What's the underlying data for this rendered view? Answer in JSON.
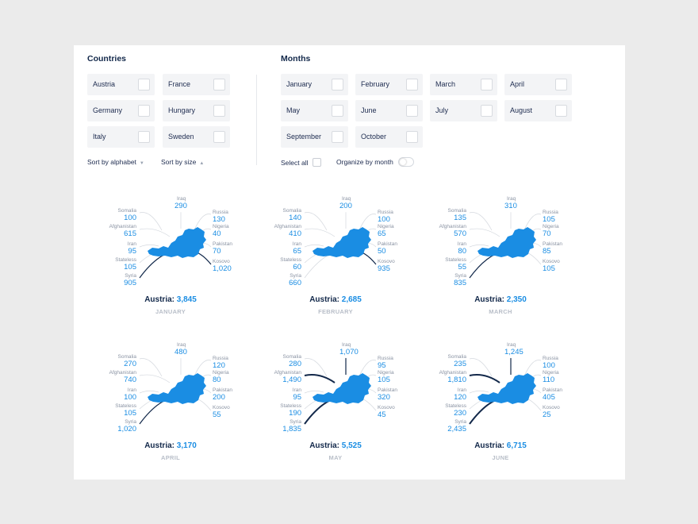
{
  "filters": {
    "countries_title": "Countries",
    "countries": [
      "Austria",
      "France",
      "Germany",
      "Hungary",
      "Italy",
      "Sweden"
    ],
    "sort_alphabet": "Sort by alphabet",
    "sort_size": "Sort by size",
    "months_title": "Months",
    "months": [
      "January",
      "February",
      "March",
      "April",
      "May",
      "June",
      "July",
      "August",
      "September",
      "October"
    ],
    "select_all": "Select all",
    "organize_by_month": "Organize by month"
  },
  "charts": [
    {
      "month": "JANUARY",
      "total_label": "Austria:",
      "total": "3,845",
      "origins": {
        "Somalia": "100",
        "Afghanistan": "615",
        "Iran": "95",
        "Stateless": "105",
        "Syria": "905",
        "Iraq": "290",
        "Russia": "130",
        "Nigeria": "40",
        "Pakistan": "70",
        "Kosovo": "1,020"
      }
    },
    {
      "month": "FEBRUARY",
      "total_label": "Austria:",
      "total": "2,685",
      "origins": {
        "Somalia": "140",
        "Afghanistan": "410",
        "Iran": "65",
        "Stateless": "60",
        "Syria": "660",
        "Iraq": "200",
        "Russia": "100",
        "Nigeria": "65",
        "Pakistan": "50",
        "Kosovo": "935"
      }
    },
    {
      "month": "MARCH",
      "total_label": "Austria:",
      "total": "2,350",
      "origins": {
        "Somalia": "135",
        "Afghanistan": "570",
        "Iran": "80",
        "Stateless": "55",
        "Syria": "835",
        "Iraq": "310",
        "Russia": "105",
        "Nigeria": "70",
        "Pakistan": "85",
        "Kosovo": "105"
      }
    },
    {
      "month": "APRIL",
      "total_label": "Austria:",
      "total": "3,170",
      "origins": {
        "Somalia": "270",
        "Afghanistan": "740",
        "Iran": "100",
        "Stateless": "105",
        "Syria": "1,020",
        "Iraq": "480",
        "Russia": "120",
        "Nigeria": "80",
        "Pakistan": "200",
        "Kosovo": "55"
      }
    },
    {
      "month": "MAY",
      "total_label": "Austria:",
      "total": "5,525",
      "origins": {
        "Somalia": "280",
        "Afghanistan": "1,490",
        "Iran": "95",
        "Stateless": "190",
        "Syria": "1,835",
        "Iraq": "1,070",
        "Russia": "95",
        "Nigeria": "105",
        "Pakistan": "320",
        "Kosovo": "45"
      }
    },
    {
      "month": "JUNE",
      "total_label": "Austria:",
      "total": "6,715",
      "origins": {
        "Somalia": "235",
        "Afghanistan": "1,810",
        "Iran": "120",
        "Stateless": "230",
        "Syria": "2,435",
        "Iraq": "1,245",
        "Russia": "100",
        "Nigeria": "110",
        "Pakistan": "405",
        "Kosovo": "25"
      }
    }
  ],
  "colors": {
    "accent": "#1a8de3",
    "title": "#12284a",
    "muted": "#8a93a3"
  }
}
